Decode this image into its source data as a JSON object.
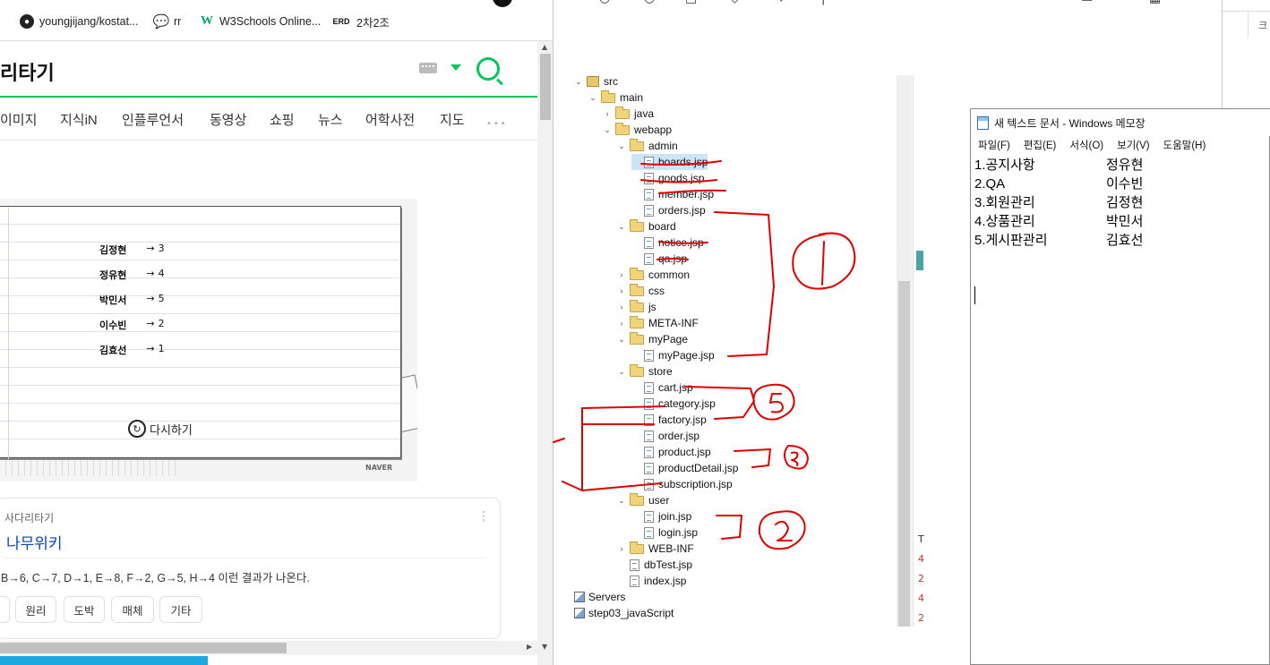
{
  "browser": {
    "bookmarks": [
      {
        "label": "youngjijang/kostat...",
        "icon": "github-icon"
      },
      {
        "label": "rr",
        "icon": "chat-icon"
      },
      {
        "label": "W3Schools Online...",
        "icon": "w3schools-icon"
      },
      {
        "label": "2차2조",
        "icon": "erd-icon",
        "badge": "ERD"
      }
    ],
    "search_title": "리타기",
    "tabs": [
      "이미지",
      "지식iN",
      "인플루언서",
      "동영상",
      "쇼핑",
      "뉴스",
      "어학사전",
      "지도"
    ],
    "more": "•••",
    "game": {
      "results": [
        {
          "name": "김정현",
          "arrow": "→",
          "value": "3"
        },
        {
          "name": "정유현",
          "arrow": "→",
          "value": "4"
        },
        {
          "name": "박민서",
          "arrow": "→",
          "value": "5"
        },
        {
          "name": "이수빈",
          "arrow": "→",
          "value": "2"
        },
        {
          "name": "김효선",
          "arrow": "→",
          "value": "1"
        }
      ],
      "retry_label": "다시하기",
      "brand": "NAVER"
    },
    "result": {
      "source": "사다리타기",
      "title": "나무위키",
      "snippet": "B→6, C→7, D→1, E→8, F→2, G→5, H→4 이런 결과가 나온다.",
      "chips": [
        "",
        "원리",
        "도박",
        "매체",
        "기타"
      ]
    }
  },
  "eclipse": {
    "tree": [
      {
        "label": "src",
        "depth": 0,
        "kind": "pkg",
        "open": true
      },
      {
        "label": "main",
        "depth": 1,
        "kind": "folder",
        "open": true
      },
      {
        "label": "java",
        "depth": 2,
        "kind": "folder",
        "open": false
      },
      {
        "label": "webapp",
        "depth": 2,
        "kind": "folder",
        "open": true
      },
      {
        "label": "admin",
        "depth": 3,
        "kind": "folder",
        "open": true
      },
      {
        "label": "boards.jsp",
        "depth": 4,
        "kind": "file",
        "selected": true
      },
      {
        "label": "goods.jsp",
        "depth": 4,
        "kind": "file"
      },
      {
        "label": "member.jsp",
        "depth": 4,
        "kind": "file"
      },
      {
        "label": "orders.jsp",
        "depth": 4,
        "kind": "file"
      },
      {
        "label": "board",
        "depth": 3,
        "kind": "folder",
        "open": true
      },
      {
        "label": "notice.jsp",
        "depth": 4,
        "kind": "file"
      },
      {
        "label": "qa.jsp",
        "depth": 4,
        "kind": "file"
      },
      {
        "label": "common",
        "depth": 3,
        "kind": "folder",
        "open": false
      },
      {
        "label": "css",
        "depth": 3,
        "kind": "folder",
        "open": false
      },
      {
        "label": "js",
        "depth": 3,
        "kind": "folder",
        "open": false
      },
      {
        "label": "META-INF",
        "depth": 3,
        "kind": "folder",
        "open": false
      },
      {
        "label": "myPage",
        "depth": 3,
        "kind": "folder",
        "open": true
      },
      {
        "label": "myPage.jsp",
        "depth": 4,
        "kind": "file"
      },
      {
        "label": "store",
        "depth": 3,
        "kind": "folder",
        "open": true
      },
      {
        "label": "cart.jsp",
        "depth": 4,
        "kind": "file"
      },
      {
        "label": "category.jsp",
        "depth": 4,
        "kind": "file"
      },
      {
        "label": "factory.jsp",
        "depth": 4,
        "kind": "file"
      },
      {
        "label": "order.jsp",
        "depth": 4,
        "kind": "file"
      },
      {
        "label": "product.jsp",
        "depth": 4,
        "kind": "file"
      },
      {
        "label": "productDetail.jsp",
        "depth": 4,
        "kind": "file"
      },
      {
        "label": "subscription.jsp",
        "depth": 4,
        "kind": "file"
      },
      {
        "label": "user",
        "depth": 3,
        "kind": "folder",
        "open": true
      },
      {
        "label": "join.jsp",
        "depth": 4,
        "kind": "file"
      },
      {
        "label": "login.jsp",
        "depth": 4,
        "kind": "file"
      },
      {
        "label": "WEB-INF",
        "depth": 3,
        "kind": "folder",
        "open": false
      },
      {
        "label": "dbTest.jsp",
        "depth": 3,
        "kind": "file"
      },
      {
        "label": "index.jsp",
        "depth": 3,
        "kind": "file"
      },
      {
        "label": "Servers",
        "depth": 0,
        "kind": "proj"
      },
      {
        "label": "step03_javaScript",
        "depth": 0,
        "kind": "proj"
      }
    ],
    "right_strip": [
      "T",
      "4",
      "2",
      "4",
      "2"
    ]
  },
  "notepad": {
    "title": "새 텍스트 문서 - Windows 메모장",
    "menus": [
      "파일(F)",
      "편집(E)",
      "서식(O)",
      "보기(V)",
      "도움말(H)"
    ],
    "lines": [
      {
        "task": "1.공지사항",
        "person": "정유현"
      },
      {
        "task": "2.QA",
        "person": "이수빈"
      },
      {
        "task": "3.회원관리",
        "person": "김정현"
      },
      {
        "task": "4.상품관리",
        "person": "박민서"
      },
      {
        "task": "5.게시판관리",
        "person": "김효선"
      }
    ]
  },
  "sliver": {
    "text": "크"
  },
  "colors": {
    "naver_green": "#03c75a",
    "annotation_red": "#e00000",
    "selection": "#cce4f7"
  }
}
